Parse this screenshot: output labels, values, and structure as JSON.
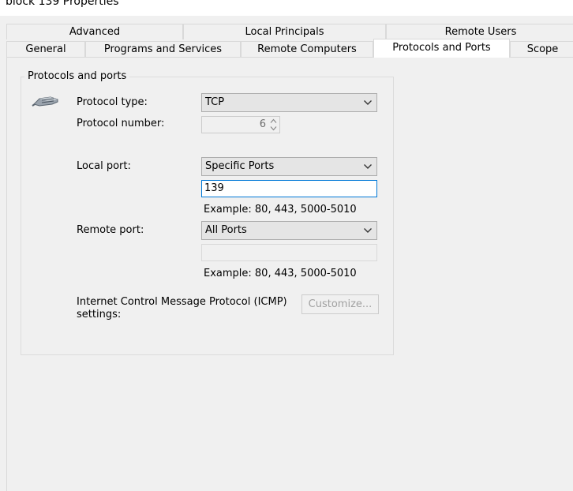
{
  "window": {
    "title": "block 139 Properties"
  },
  "tabs_row1": [
    {
      "label": "Advanced"
    },
    {
      "label": "Local Principals"
    },
    {
      "label": "Remote Users"
    }
  ],
  "tabs_row2": [
    {
      "label": "General"
    },
    {
      "label": "Programs and Services"
    },
    {
      "label": "Remote Computers"
    },
    {
      "label": "Protocols and Ports",
      "active": true
    },
    {
      "label": "Scope"
    }
  ],
  "group": {
    "title": "Protocols and ports",
    "icon": "network-cable-icon",
    "protocol_type_label": "Protocol type:",
    "protocol_type_value": "TCP",
    "protocol_number_label": "Protocol number:",
    "protocol_number_value": "6",
    "local_port_label": "Local port:",
    "local_port_mode": "Specific Ports",
    "local_port_value": "139",
    "local_port_hint": "Example: 80, 443, 5000-5010",
    "remote_port_label": "Remote port:",
    "remote_port_mode": "All Ports",
    "remote_port_value": "",
    "remote_port_hint": "Example: 80, 443, 5000-5010",
    "icmp_label": "Internet Control Message Protocol (ICMP) settings:",
    "customize_label": "Customize..."
  },
  "colors": {
    "accent_border": "#0078d7",
    "disabled_text": "#a0a0a0",
    "background": "#f0f0f0"
  }
}
